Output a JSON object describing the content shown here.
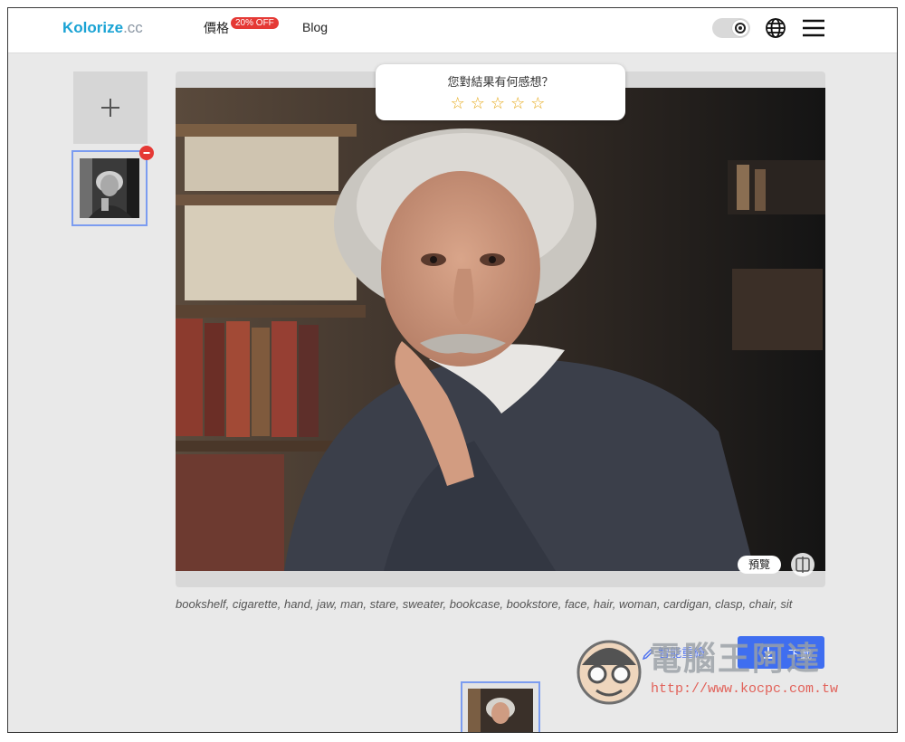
{
  "header": {
    "logo_brand": "Kolorize",
    "logo_suffix": ".cc",
    "nav_pricing": "價格",
    "pricing_badge": "20% OFF",
    "nav_blog": "Blog",
    "icons": [
      "theme-toggle-icon",
      "globe-icon",
      "hamburger-menu-icon"
    ]
  },
  "sidebar": {
    "add_label": "+"
  },
  "feedback": {
    "question": "您對結果有何感想？",
    "stars": "☆☆☆☆☆"
  },
  "viewer": {
    "preview_label": "預覽"
  },
  "tags_text": "bookshelf, cigarette, hand, jaw, man, stare, sweater, bookcase, bookstore, face, hair, woman, cardigan, clasp, chair, sit",
  "actions": {
    "edit_label": "智能重繪",
    "download_label": "下載"
  },
  "watermark": {
    "title": "電腦王阿達",
    "url": "http://www.kocpc.com.tw"
  },
  "colors": {
    "accent": "#3f6ef0",
    "logo_blue": "#1aa3d4",
    "badge_red": "#e53935",
    "star_gold": "#e6a817",
    "selection_border": "#7b9cf0"
  }
}
